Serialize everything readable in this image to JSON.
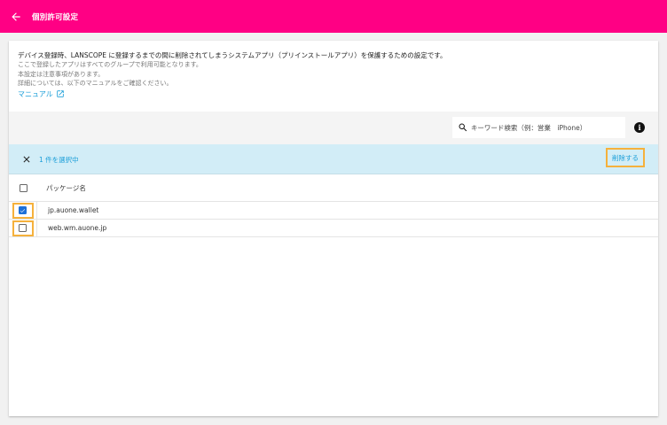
{
  "header": {
    "title": "個別許可設定"
  },
  "description": {
    "main": "デバイス登録時、LANSCOPE に登録するまでの間に削除されてしまうシステムアプリ（プリインストールアプリ）を保護するための設定です。",
    "lines": [
      "ここで登録したアプリはすべてのグループで利用可能となります。",
      "本設定は注意事項があります。",
      "詳細については、以下のマニュアルをご確認ください。"
    ],
    "manual_link": "マニュアル"
  },
  "search": {
    "placeholder": "キーワード検索（例：営業　iPhone）",
    "value": ""
  },
  "selection": {
    "count_label": "1 件を選択中",
    "delete_label": "削除する"
  },
  "table": {
    "columns": [
      "パッケージ名"
    ],
    "rows": [
      {
        "package": "jp.auone.wallet",
        "checked": true
      },
      {
        "package": "web.wm.auone.jp",
        "checked": false
      }
    ]
  },
  "colors": {
    "accent": "#ff0084",
    "link": "#1a9ed8",
    "selection_bar": "#d2edf7",
    "highlight": "#f5b13c",
    "checkbox": "#1d70d8"
  },
  "icons": {
    "back": "arrow-left-icon",
    "external": "external-link-icon",
    "search": "search-icon",
    "info": "info-icon",
    "close": "close-icon"
  }
}
